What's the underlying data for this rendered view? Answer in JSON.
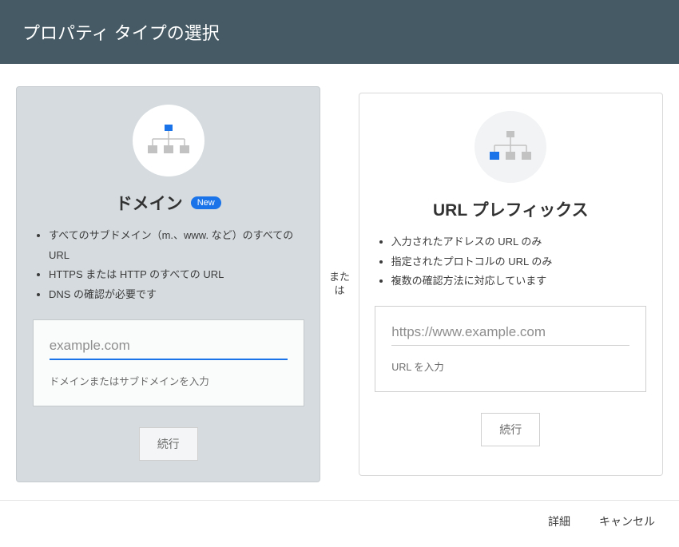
{
  "header": {
    "title": "プロパティ タイプの選択"
  },
  "divider": "または",
  "cards": {
    "domain": {
      "title": "ドメイン",
      "badge": "New",
      "bullets": [
        "すべてのサブドメイン（m.、www. など）のすべての URL",
        "HTTPS または HTTP のすべての URL",
        "DNS の確認が必要です"
      ],
      "input_placeholder": "example.com",
      "helper": "ドメインまたはサブドメインを入力",
      "button": "続行"
    },
    "urlprefix": {
      "title": "URL プレフィックス",
      "bullets": [
        "入力されたアドレスの URL のみ",
        "指定されたプロトコルの URL のみ",
        "複数の確認方法に対応しています"
      ],
      "input_placeholder": "https://www.example.com",
      "helper": "URL を入力",
      "button": "続行"
    }
  },
  "footer": {
    "details": "詳細",
    "cancel": "キャンセル"
  }
}
